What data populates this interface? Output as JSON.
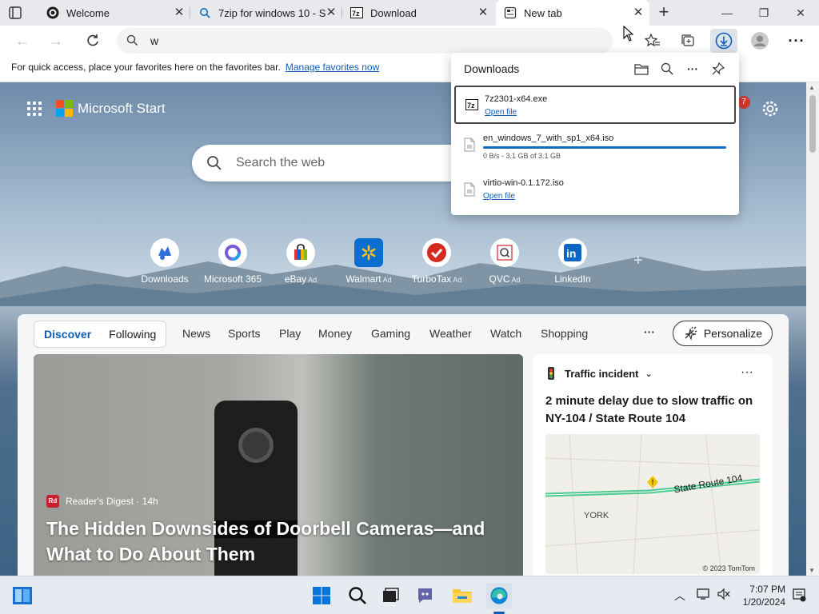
{
  "tabs": [
    {
      "title": "Welcome",
      "icon": "edge-welcome-icon"
    },
    {
      "title": "7zip for windows 10 - S",
      "icon": "search-icon"
    },
    {
      "title": "Download",
      "icon": "7zip-icon"
    },
    {
      "title": "New tab",
      "icon": "newtab-icon",
      "active": true
    }
  ],
  "address": {
    "value": "w"
  },
  "favorites_bar": {
    "text": "For quick access, place your favorites here on the favorites bar.",
    "link": "Manage favorites now"
  },
  "start": {
    "brand": "Microsoft Start",
    "notification_count": "7",
    "search_placeholder": "Search the web",
    "quick_links": [
      {
        "label": "Downloads",
        "ad": ""
      },
      {
        "label": "Microsoft 365",
        "ad": ""
      },
      {
        "label": "eBay",
        "ad": "Ad"
      },
      {
        "label": "Walmart",
        "ad": "Ad"
      },
      {
        "label": "TurboTax",
        "ad": "Ad"
      },
      {
        "label": "QVC",
        "ad": "Ad"
      },
      {
        "label": "LinkedIn",
        "ad": ""
      }
    ]
  },
  "feed": {
    "segment": [
      "Discover",
      "Following"
    ],
    "tabs": [
      "News",
      "Sports",
      "Play",
      "Money",
      "Gaming",
      "Weather",
      "Watch",
      "Shopping"
    ],
    "more": "···",
    "personalize": "Personalize",
    "article": {
      "source": "Reader's Digest · 14h",
      "source_badge": "Rd",
      "title": "The Hidden Downsides of Doorbell Cameras—and What to Do About Them"
    },
    "traffic": {
      "header": "Traffic incident",
      "more": "···",
      "message": "2 minute delay due to slow traffic on NY-104 / State Route 104",
      "map_place": "YORK",
      "map_route": "State Route 104",
      "map_copyright": "© 2023 TomTom"
    }
  },
  "downloads": {
    "title": "Downloads",
    "items": [
      {
        "name": "7z2301-x64.exe",
        "action": "Open file"
      },
      {
        "name": "en_windows_7_with_sp1_x64.iso",
        "status": "0 B/s - 3.1 GB of 3.1 GB",
        "progress": 1.0
      },
      {
        "name": "virtio-win-0.1.172.iso",
        "action": "Open file"
      }
    ]
  },
  "taskbar": {
    "time": "7:07 PM",
    "date": "1/20/2024"
  },
  "colors": {
    "accent": "#0f5db5",
    "tabbar": "#e7e9ec",
    "taskbar": "#e6ebf2",
    "badge": "#d13b2f"
  }
}
